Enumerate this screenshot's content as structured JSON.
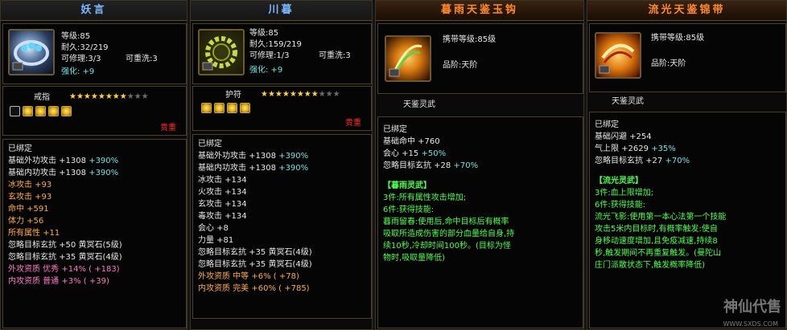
{
  "panels": [
    {
      "title": "妖言",
      "info": [
        "等级:85",
        "耐久:32/219"
      ],
      "repair": "可修理:3/3",
      "rewash": "可重洗:3",
      "enhance": "强化: +9",
      "type": "戒指",
      "stars_on": 8,
      "stars_off": 3,
      "sockets": [
        "empty",
        "filled",
        "filled",
        "filled",
        "filled"
      ],
      "quality": "贵重",
      "bound": "已绑定",
      "stats": [
        {
          "t": "基础外功攻击 +1308",
          "b": " +390%"
        },
        {
          "t": "基础内功攻击 +1308",
          "b": " +390%"
        }
      ],
      "extras": [
        "冰攻击 +93",
        "玄攻击 +93",
        "命中 +591",
        "体力 +56",
        "所有属性 +11",
        "忽略目标玄抗 +50 黄冥石(5级)",
        "忽略目标玄抗 +35 黄冥石(4级)"
      ],
      "aptitude": [
        "外攻资质  优秀 +14% ( +183)",
        "内攻资质  普通 +3% ( +39)"
      ]
    },
    {
      "title": "川暮",
      "info": [
        "等级:85",
        "耐久:159/219"
      ],
      "repair": "可修理:1/3",
      "rewash": "可重洗:3",
      "enhance": "强化: +9",
      "type": "护符",
      "stars_on": 8,
      "stars_off": 3,
      "sockets": [
        "filled",
        "filled",
        "filled",
        "filled"
      ],
      "quality": "贵重",
      "bound": "已绑定",
      "stats": [
        {
          "t": "基础外功攻击 +1308",
          "b": " +390%"
        },
        {
          "t": "基础内功攻击 +1308",
          "b": " +390%"
        }
      ],
      "extras": [
        "冰攻击 +134",
        "火攻击 +134",
        "玄攻击 +134",
        "毒攻击 +134",
        "会心 +8",
        "力量 +81",
        "忽略目标玄抗 +35 黄冥石(4级)",
        "忽略目标玄抗 +35 黄冥石(4级)"
      ],
      "aptitude": [
        "外攻资质  中等 +6% ( +78)",
        "内攻资质  完美 +60% ( +785)"
      ]
    },
    {
      "title": "暮雨天鉴玉钩",
      "carry": "携带等级:85级",
      "grade": "品阶:天阶",
      "set": "天鉴灵武",
      "bound": "已绑定",
      "stats": [
        {
          "t": "基础命中 +760",
          "b": ""
        },
        {
          "t": "会心 +15",
          "b": " +50%"
        },
        {
          "t": "忽略目标玄抗 +28",
          "b": " +70%"
        }
      ],
      "set_title": "【暮雨灵武】",
      "set_lines": [
        "3件:所有属性攻击增加;",
        "6件:获得技能:",
        "暮雨留春:使用后,命中目标后有概率",
        "吸取所造成伤害的部分血量给自身,持",
        "续10秒,冷却时间100秒。(目标为怪",
        "物时,吸取量降低)"
      ]
    },
    {
      "title": "流光天鉴锦带",
      "carry": "携带等级:85级",
      "grade": "品阶:天阶",
      "set": "天鉴灵武",
      "bound": "已绑定",
      "stats": [
        {
          "t": "基础闪避 +254",
          "b": ""
        },
        {
          "t": "气上限 +2629",
          "b": " +35%"
        },
        {
          "t": "忽略目标玄抗 +27",
          "b": " +70%"
        }
      ],
      "set_title": "【流光灵武】",
      "set_lines": [
        "3件:血上限增加;",
        "6件:获得技能:",
        "流光飞影:使用第一本心法第一个技能",
        "攻击5米内目标时,有概率触发:使自",
        "身移动速度增加,且免疫减速,持续8",
        "秒,触发期间不再重复触发。(曼陀山",
        "庄门派散状态下,触发概率降低)"
      ]
    }
  ],
  "watermark": "神仙代售",
  "watermark_url": "WWW.SXDS.COM"
}
